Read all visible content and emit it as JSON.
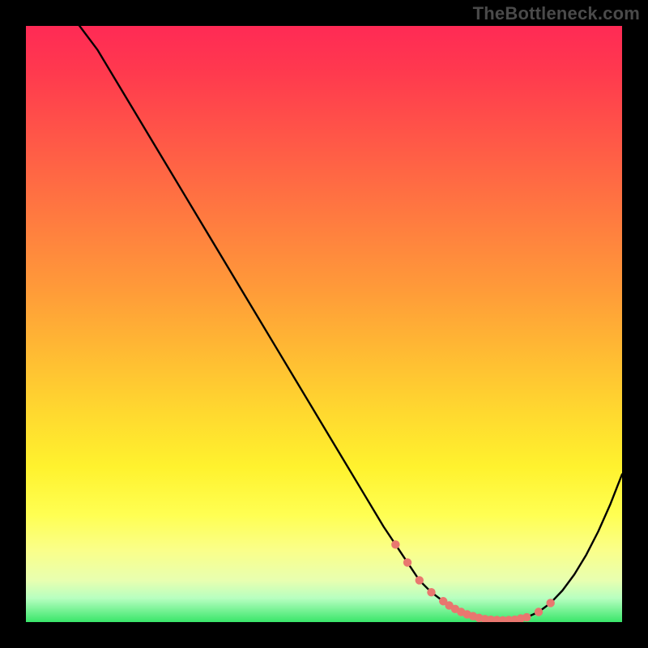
{
  "watermark": "TheBottleneck.com",
  "colors": {
    "background": "#000000",
    "watermark_text": "#4a4a4a",
    "curve_stroke": "#000000",
    "marker_fill": "#e9776f",
    "gradient_top": "#ff2a55",
    "gradient_bottom": "#39e66a"
  },
  "chart_data": {
    "type": "line",
    "title": "",
    "xlabel": "",
    "ylabel": "",
    "xlim": [
      0,
      100
    ],
    "ylim": [
      0,
      100
    ],
    "grid": false,
    "legend": false,
    "series": [
      {
        "name": "bottleneck_curve",
        "x": [
          0,
          3,
          6,
          9,
          12,
          15,
          18,
          21,
          24,
          27,
          30,
          33,
          36,
          39,
          42,
          45,
          48,
          51,
          54,
          57,
          60,
          62,
          64,
          66,
          68,
          70,
          72,
          74,
          76,
          78,
          80,
          82,
          84,
          86,
          88,
          90,
          92,
          94,
          96,
          98,
          100
        ],
        "y": [
          115,
          109,
          103,
          100,
          96,
          91,
          86,
          81,
          76,
          71,
          66,
          61,
          56,
          51,
          46,
          41,
          36,
          31,
          26,
          21,
          16,
          13,
          10,
          7,
          5,
          3.5,
          2.2,
          1.3,
          0.7,
          0.4,
          0.3,
          0.4,
          0.8,
          1.7,
          3.2,
          5.3,
          8,
          11.3,
          15.2,
          19.7,
          24.8
        ]
      }
    ],
    "markers": {
      "name": "highlight_segment",
      "x": [
        62,
        64,
        66,
        68,
        70,
        71,
        72,
        73,
        74,
        75,
        76,
        77,
        78,
        79,
        80,
        81,
        82,
        83,
        84,
        86,
        88
      ],
      "y": [
        13,
        10,
        7,
        5,
        3.5,
        2.8,
        2.2,
        1.7,
        1.3,
        1.0,
        0.7,
        0.5,
        0.4,
        0.35,
        0.3,
        0.35,
        0.4,
        0.6,
        0.8,
        1.7,
        3.2
      ]
    }
  }
}
